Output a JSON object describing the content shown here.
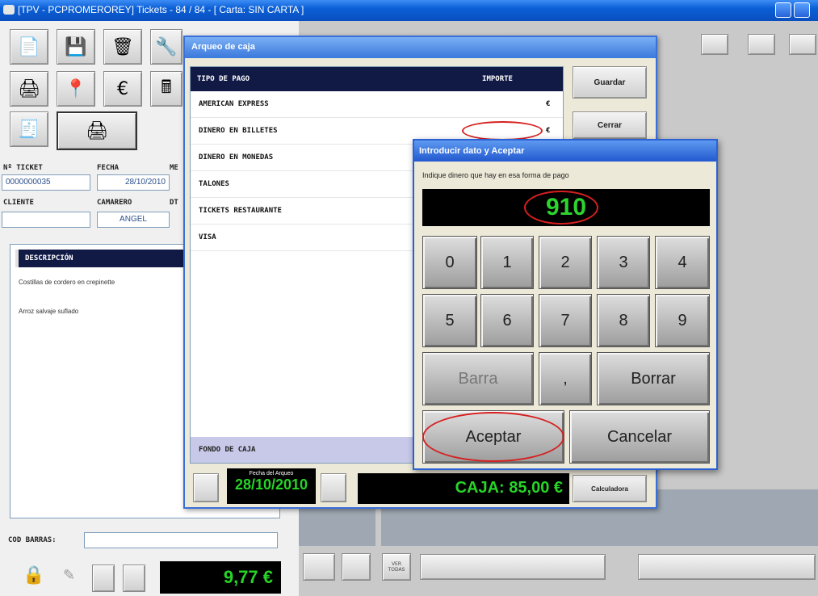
{
  "window": {
    "title": "[TPV - PCPROMEROREY] Tickets - 84 / 84 - [ Carta: SIN CARTA ]"
  },
  "left": {
    "ticket_label": "Nº TICKET",
    "ticket_value": "0000000035",
    "fecha_label": "FECHA",
    "fecha_value": "28/10/2010",
    "me_label": "ME",
    "cliente_label": "CLIENTE",
    "camarero_label": "CAMARERO",
    "camarero_value": "ANGEL",
    "dt_label": "DT",
    "desc_header": "DESCRIPCIÓN",
    "items": [
      "Costillas de cordero en crepinette",
      "Arroz salvaje suflado"
    ],
    "cod_barras_label": "COD BARRAS:",
    "total": "9,77 €"
  },
  "arqueo": {
    "title": "Arqueo de caja",
    "col_tipo": "TIPO DE PAGO",
    "col_importe": "IMPORTE",
    "currency": "€",
    "rows": [
      "AMERICAN EXPRESS",
      "DINERO EN BILLETES",
      "DINERO EN MONEDAS",
      "TALONES",
      "TICKETS RESTAURANTE",
      "VISA"
    ],
    "fondo": "FONDO DE CAJA",
    "guardar": "Guardar",
    "cerrar": "Cerrar",
    "fecha_arqueo_label": "Fecha del Arqueo",
    "fecha_arqueo": "28/10/2010",
    "caja": "CAJA: 85,00 €",
    "calculadora": "Calculadora"
  },
  "keypad": {
    "title": "Introducir dato y Aceptar",
    "prompt": "Indique dinero que hay en esa forma de pago",
    "value": "910",
    "keys": [
      "0",
      "1",
      "2",
      "3",
      "4",
      "5",
      "6",
      "7",
      "8",
      "9"
    ],
    "barra": "Barra",
    "comma": ",",
    "borrar": "Borrar",
    "aceptar": "Aceptar",
    "cancelar": "Cancelar"
  },
  "bottom": {
    "ver_todas": "VER TODAS"
  }
}
